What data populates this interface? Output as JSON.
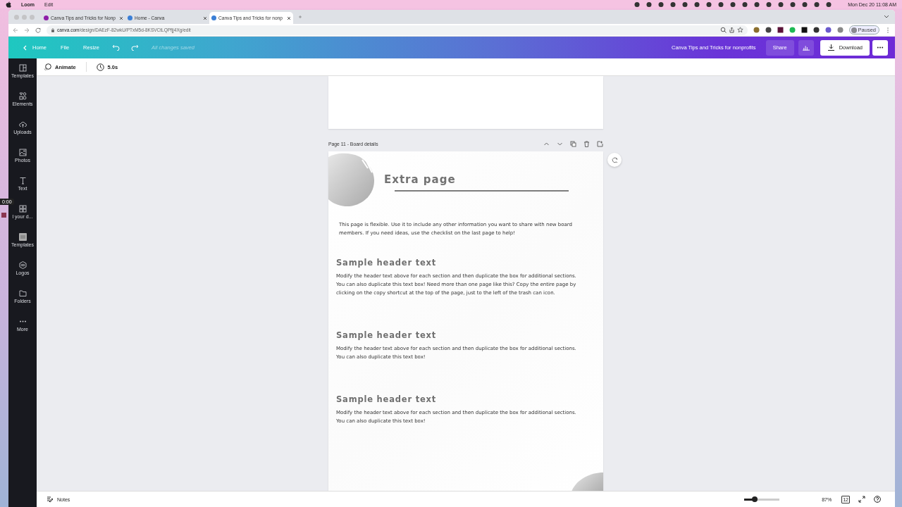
{
  "menubar": {
    "app": "Loom",
    "menus": [
      "Edit"
    ],
    "clock": "Mon Dec 20  11:08 AM"
  },
  "browser": {
    "tabs": [
      {
        "title": "Canva Tips and Tricks for Nonp",
        "color": "#8e1fa8",
        "selected": false
      },
      {
        "title": "Home - Canva",
        "color": "#3b7fd6",
        "selected": false
      },
      {
        "title": "Canva Tips and Tricks for nonp",
        "color": "#3b7fd6",
        "selected": true
      }
    ],
    "url_host": "canva.com",
    "url_path": "/design/DAEzF-82wkU/PTxM5d-8KSVCtLQPfjj4Xg/edit",
    "profile_status": "Paused"
  },
  "header": {
    "nav": [
      "Home",
      "File",
      "Resize"
    ],
    "save_status": "All changes saved",
    "design_title": "Canva Tips and Tricks for nonprofits",
    "share": "Share",
    "download": "Download"
  },
  "toolbar": {
    "animate": "Animate",
    "duration": "5.0s"
  },
  "sidebar": [
    {
      "label": "Templates",
      "kind": "templates"
    },
    {
      "label": "Elements",
      "kind": "elements"
    },
    {
      "label": "Uploads",
      "kind": "uploads"
    },
    {
      "label": "Photos",
      "kind": "photos"
    },
    {
      "label": "Text",
      "kind": "text"
    },
    {
      "label": "l your d...",
      "kind": "apps"
    },
    {
      "label": "Templates",
      "kind": "brand"
    },
    {
      "label": "Logos",
      "kind": "logos"
    },
    {
      "label": "Folders",
      "kind": "folders"
    },
    {
      "label": "More",
      "kind": "more"
    }
  ],
  "recorder": {
    "timer": "0:00"
  },
  "page": {
    "title": "Page 11 - Board details",
    "heading": "Extra page",
    "intro": "This page is flexible. Use it to include any other information you want to share with new board members. If you need ideas, use the checklist on the last page to help!",
    "sections": [
      {
        "header": "Sample header text",
        "body": "Modify the header text above for each section and then duplicate the box for additional sections. You can also duplicate this text box! Need more than one page like this? Copy the entire page by clicking on the copy shortcut at the top of the page, just to the left of the trash can icon."
      },
      {
        "header": "Sample header text",
        "body": "Modify the header text above for each section and then duplicate the box for additional sections. You can also duplicate this text box!"
      },
      {
        "header": "Sample header text",
        "body": "Modify the header text above for each section and then duplicate the box for additional sections. You can also duplicate this text box!"
      }
    ]
  },
  "footer": {
    "notes": "Notes",
    "zoom": {
      "level": 0.3,
      "reading": "87%"
    },
    "page_count": "12"
  }
}
